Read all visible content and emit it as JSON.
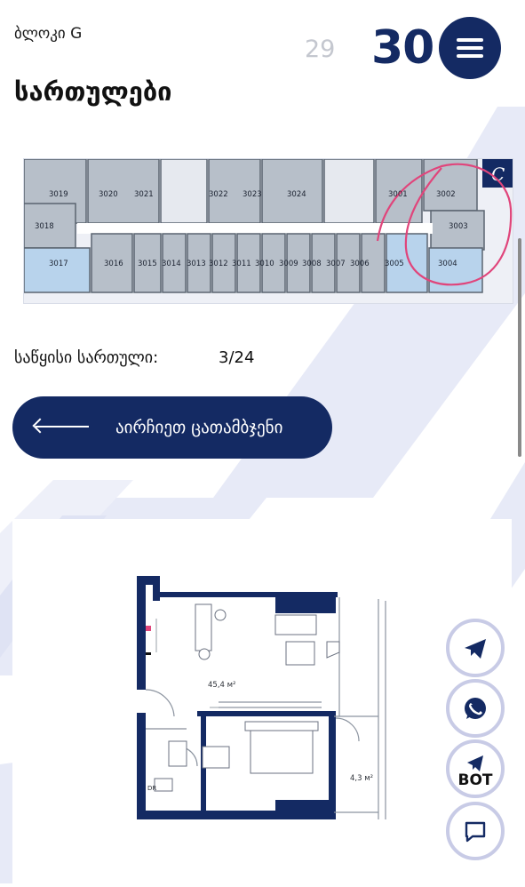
{
  "header": {
    "block_label": "ბლოკი G",
    "title": "სართულები",
    "prev_floor": "29",
    "current_floor": "30"
  },
  "floor_plan": {
    "units_top": [
      "3019",
      "3020",
      "3021",
      "3022",
      "3023",
      "3024",
      "3001",
      "3002"
    ],
    "units_right": [
      "3003"
    ],
    "units_left": [
      "3018"
    ],
    "units_bottom": [
      "3017",
      "3016",
      "3015",
      "3014",
      "3013",
      "3012",
      "3011",
      "3010",
      "3009",
      "3008",
      "3007",
      "3006",
      "3005",
      "3004"
    ],
    "corner_logo": "C"
  },
  "start_floor": {
    "label": "საწყისი სართული:",
    "value": "3/24"
  },
  "choose_button": {
    "label": "აირჩიეთ ცათამბჯენი"
  },
  "apartment": {
    "area_main": "45,4 м²",
    "area_balcony": "4,3 м²",
    "dr_label": "DR"
  },
  "fabs": {
    "bot_label": "BOT"
  },
  "colors": {
    "primary": "#142a63",
    "stripe": "#e4e7f6",
    "fab_ring": "#c8cbe6",
    "annotation": "#e0457b"
  },
  "icons": [
    "menu-icon",
    "arrow-left-icon",
    "telegram-icon",
    "whatsapp-icon",
    "bot-icon",
    "chat-icon"
  ]
}
